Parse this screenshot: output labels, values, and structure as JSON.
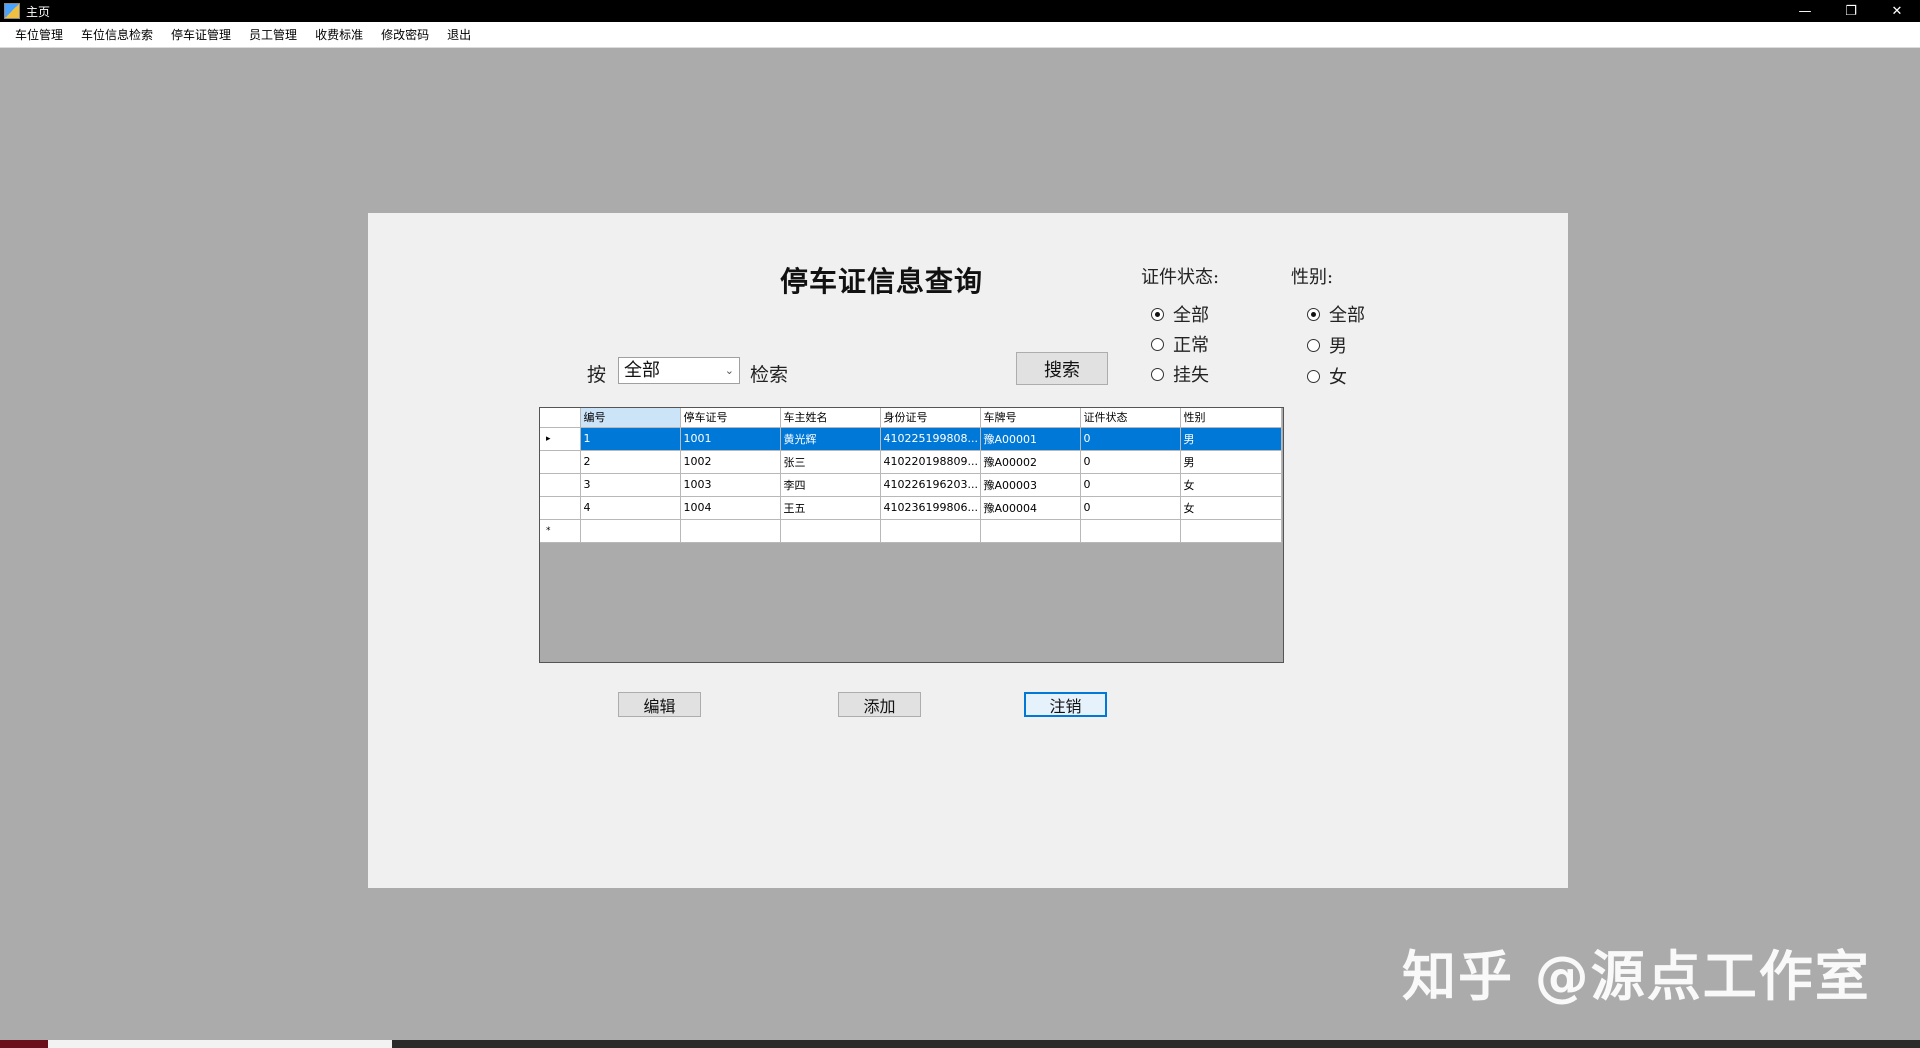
{
  "window": {
    "title": "主页",
    "minimize": "—",
    "restore": "❐",
    "close": "✕"
  },
  "menu": [
    "车位管理",
    "车位信息检索",
    "停车证管理",
    "员工管理",
    "收费标准",
    "修改密码",
    "退出"
  ],
  "form": {
    "title": "停车证信息查询",
    "status_group": {
      "label": "证件状态:",
      "options": [
        "全部",
        "正常",
        "挂失"
      ],
      "selected": "全部"
    },
    "gender_group": {
      "label": "性别:",
      "options": [
        "全部",
        "男",
        "女"
      ],
      "selected": "全部"
    },
    "search": {
      "prefix": "按",
      "selected": "全部",
      "suffix": "检索",
      "button": "搜索"
    },
    "buttons": {
      "edit": "编辑",
      "add": "添加",
      "cancel": "注销"
    }
  },
  "grid": {
    "columns": [
      "编号",
      "停车证号",
      "车主姓名",
      "身份证号",
      "车牌号",
      "证件状态",
      "性别"
    ],
    "rows": [
      [
        "1",
        "1001",
        "黄光辉",
        "410225199808...",
        "豫A00001",
        "0",
        "男"
      ],
      [
        "2",
        "1002",
        "张三",
        "410220198809...",
        "豫A00002",
        "0",
        "男"
      ],
      [
        "3",
        "1003",
        "李四",
        "410226196203...",
        "豫A00003",
        "0",
        "女"
      ],
      [
        "4",
        "1004",
        "王五",
        "410236199806...",
        "豫A00004",
        "0",
        "女"
      ]
    ],
    "selected_row": 0,
    "current_row_marker": "▸",
    "new_row_marker": "*"
  },
  "watermark": "知乎 @源点工作室"
}
